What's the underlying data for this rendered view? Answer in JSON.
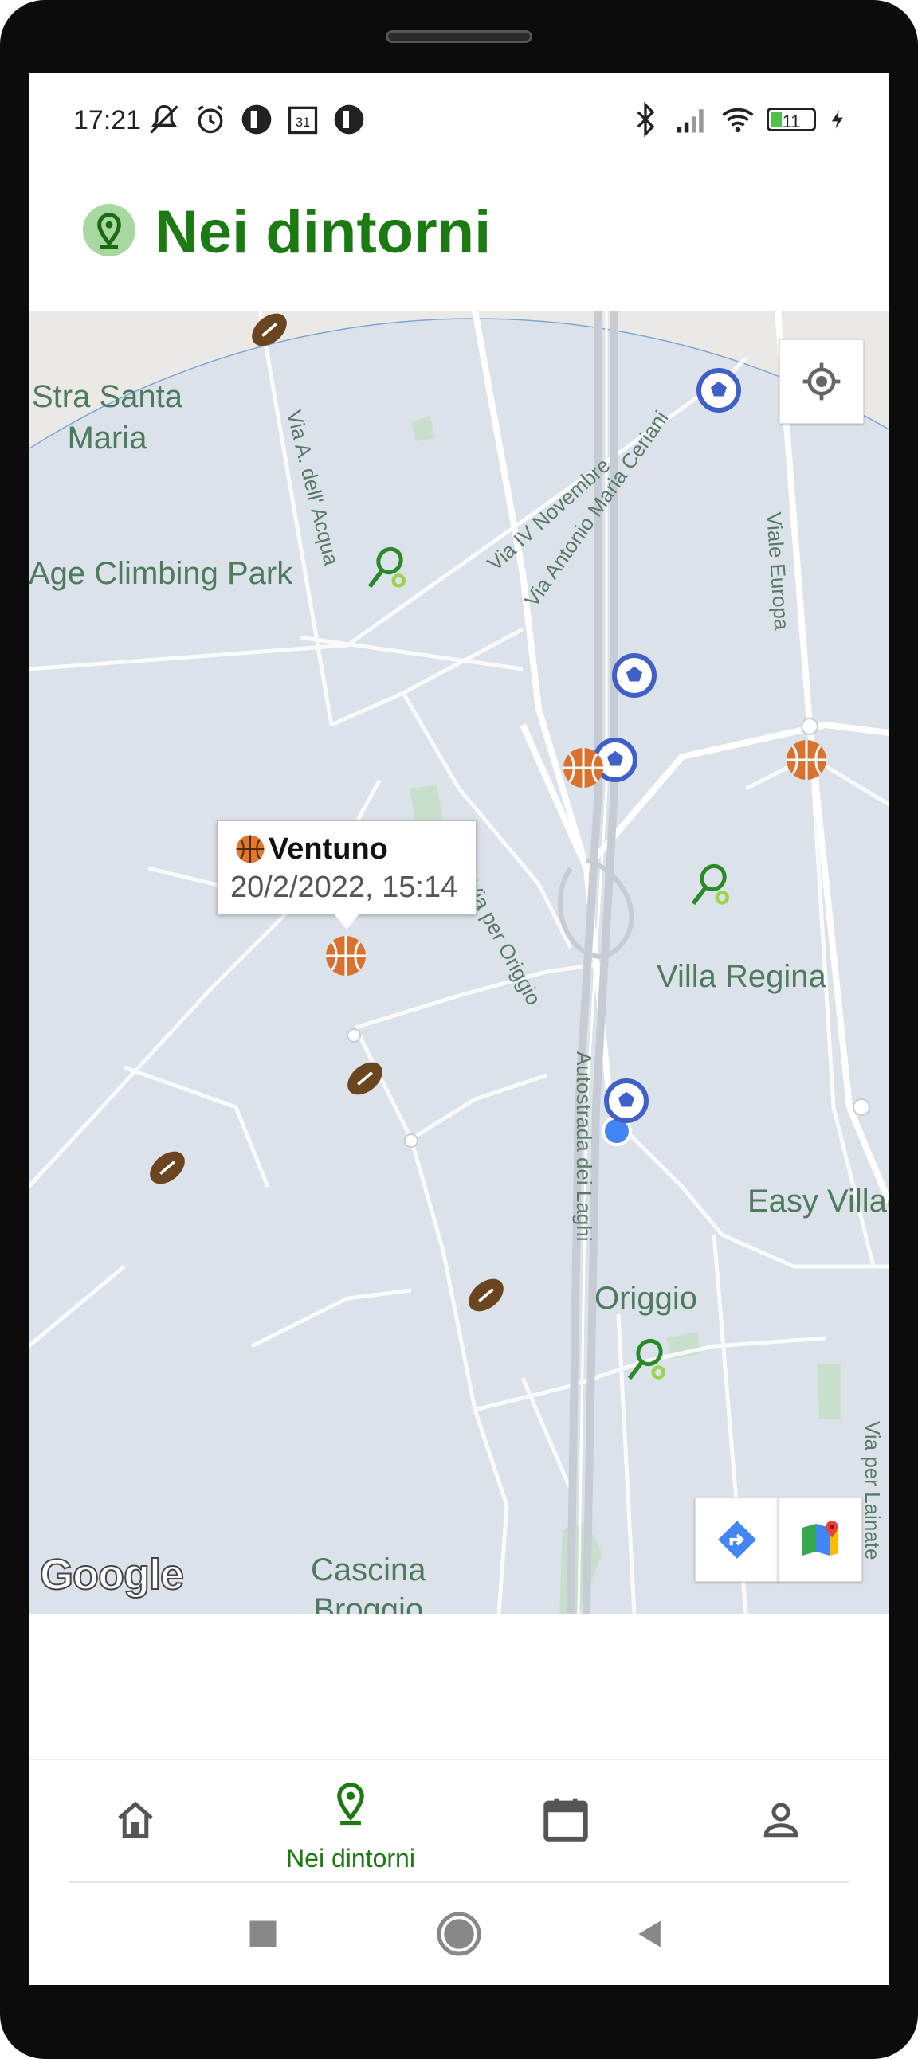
{
  "status_bar": {
    "time": "17:21",
    "battery": "11",
    "icons_left": [
      "mute-icon",
      "alarm-icon",
      "app-icon",
      "calendar-icon",
      "app-icon"
    ],
    "icons_right": [
      "bluetooth-icon",
      "signal-icon",
      "wifi-icon",
      "battery-icon",
      "charging-icon"
    ]
  },
  "header": {
    "title": "Nei dintorni",
    "icon": "location-pin-icon"
  },
  "map": {
    "place_labels": {
      "stra_santa_maria": "Stra Santa\nMaria",
      "climbing_park": "Age Climbing Park",
      "villa_regina": "Villa Regina",
      "easy_village": "Easy Villag",
      "origgio": "Origgio",
      "cascina": "Cascina\nBroggio"
    },
    "road_labels": {
      "via_dell_acqua": "Via A. dell' Acqua",
      "via_iv_novembre": "Via IV Novembre",
      "via_ceriani": "Via Antonio Maria Ceriani",
      "viale_europa": "Viale Europa",
      "via_per_origgio": "Via per Origgio",
      "autostrada": "Autostrada dei Laghi",
      "via_per_lainate": "Via per Lainate"
    },
    "info_window": {
      "title": "Ventuno",
      "subtitle": "20/2/2022, 15:14"
    },
    "attribution": "Google",
    "colors": {
      "radius_fill": "#dde3ea",
      "football": "#6b4420",
      "soccer": "#3f5fc9",
      "tennis": "#2a8a2a",
      "basketball": "#d9722e"
    }
  },
  "bottom_nav": {
    "items": [
      {
        "name": "home",
        "label": ""
      },
      {
        "name": "nearby",
        "label": "Nei dintorni"
      },
      {
        "name": "calendar",
        "label": ""
      },
      {
        "name": "profile",
        "label": ""
      }
    ]
  }
}
